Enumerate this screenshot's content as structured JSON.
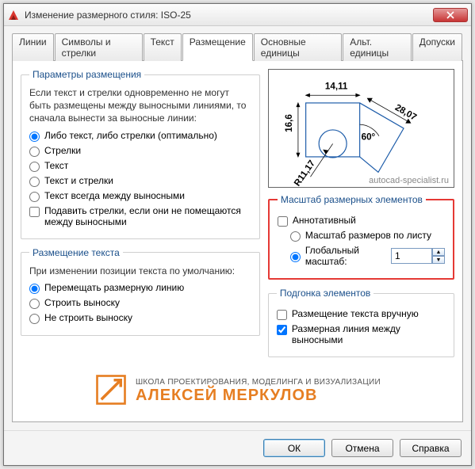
{
  "window": {
    "title": "Изменение размерного стиля: ISO-25"
  },
  "tabs": [
    "Линии",
    "Символы и стрелки",
    "Текст",
    "Размещение",
    "Основные единицы",
    "Альт. единицы",
    "Допуски"
  ],
  "active_tab": 3,
  "fit_options": {
    "legend": "Параметры размещения",
    "desc": "Если текст и стрелки одновременно не могут быть размещены между выносными линиями, то сначала вынести за выносные линии:",
    "radios": [
      "Либо текст, либо стрелки (оптимально)",
      "Стрелки",
      "Текст",
      "Текст и стрелки",
      "Текст всегда между выносными"
    ],
    "radio_selected": 0,
    "suppress_label": "Подавить стрелки, если они не помещаются между выносными",
    "suppress_checked": false
  },
  "text_placement": {
    "legend": "Размещение текста",
    "desc": "При изменении позиции текста по умолчанию:",
    "radios": [
      "Перемещать размерную линию",
      "Строить выноску",
      "Не строить выноску"
    ],
    "radio_selected": 0
  },
  "preview": {
    "dims": [
      "14,11",
      "16,6",
      "28,07",
      "R11,17",
      "60°"
    ],
    "watermark": "autocad-specialist.ru"
  },
  "scale": {
    "legend": "Масштаб размерных элементов",
    "annotative_label": "Аннотативный",
    "annotative_checked": false,
    "radios": [
      "Масштаб размеров по листу",
      "Глобальный масштаб:"
    ],
    "radio_selected": 1,
    "global_value": "1"
  },
  "fine": {
    "legend": "Подгонка элементов",
    "manual_label": "Размещение текста вручную",
    "manual_checked": false,
    "dimline_label": "Размерная линия между выносными",
    "dimline_checked": true
  },
  "logo": {
    "line1": "ШКОЛА  ПРОЕКТИРОВАНИЯ, МОДЕЛИНГА И ВИЗУАЛИЗАЦИИ",
    "line2": "АЛЕКСЕЙ МЕРКУЛОВ"
  },
  "buttons": {
    "ok": "ОК",
    "cancel": "Отмена",
    "help": "Справка"
  }
}
